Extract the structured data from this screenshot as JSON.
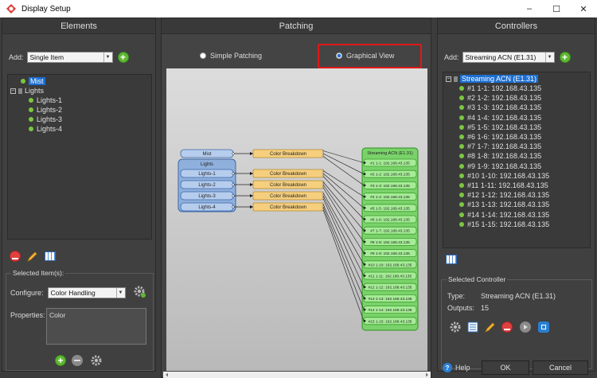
{
  "window": {
    "title": "Display Setup",
    "min": "–",
    "max": "☐",
    "close": "✕"
  },
  "elements": {
    "header": "Elements",
    "add_label": "Add:",
    "add_value": "Single Item",
    "tree": [
      {
        "label": "Mist",
        "selected": true
      },
      {
        "label": "Lights"
      },
      {
        "label": "Lights-1"
      },
      {
        "label": "Lights-2"
      },
      {
        "label": "Lights-3"
      },
      {
        "label": "Lights-4"
      }
    ],
    "selected_items": "Selected Item(s):",
    "configure_label": "Configure:",
    "configure_value": "Color Handling",
    "properties_label": "Properties:",
    "properties_value": "Color"
  },
  "patching": {
    "header": "Patching",
    "simple": "Simple Patching",
    "graphical": "Graphical View",
    "graph": {
      "mist": "Mist",
      "group": "Lights",
      "lights": [
        "Lights-1",
        "Lights-2",
        "Lights-3",
        "Lights-4"
      ],
      "breakdown": "Color Breakdown",
      "controller": "Streaming ACN (E1.31)",
      "outputs": [
        "#1 1-1: 192.168.43.135",
        "#2 1-2: 192.168.43.135",
        "#3 1-3: 192.168.43.135",
        "#4 1-4: 192.168.43.135",
        "#5 1-5: 192.168.43.135",
        "#6 1-6: 192.168.43.135",
        "#7 1-7: 192.168.43.135",
        "#8 1-8: 192.168.43.135",
        "#9 1-9: 192.168.43.135",
        "#10 1-10: 192.168.43.135",
        "#11 1-11: 192.168.43.135",
        "#12 1-12: 192.168.43.135",
        "#13 1-13: 192.168.43.135",
        "#14 1-14: 192.168.43.135",
        "#15 1-15: 192.168.43.135"
      ]
    }
  },
  "controllers": {
    "header": "Controllers",
    "add_label": "Add:",
    "add_value": "Streaming ACN (E1.31)",
    "root": "Streaming ACN (E1.31)",
    "outputs": [
      "#1 1-1: 192.168.43.135",
      "#2 1-2: 192.168.43.135",
      "#3 1-3: 192.168.43.135",
      "#4 1-4: 192.168.43.135",
      "#5 1-5: 192.168.43.135",
      "#6 1-6: 192.168.43.135",
      "#7 1-7: 192.168.43.135",
      "#8 1-8: 192.168.43.135",
      "#9 1-9: 192.168.43.135",
      "#10 1-10: 192.168.43.135",
      "#11 1-11: 192.168.43.135",
      "#12 1-12: 192.168.43.135",
      "#13 1-13: 192.168.43.135",
      "#14 1-14: 192.168.43.135",
      "#15 1-15: 192.168.43.135"
    ],
    "selected_controller": "Selected Controller",
    "type_label": "Type:",
    "type_value": "Streaming ACN (E1.31)",
    "outputs_label": "Outputs:",
    "outputs_value": "15"
  },
  "footer": {
    "help": "Help",
    "ok": "OK",
    "cancel": "Cancel"
  },
  "colors": {
    "accent": "#1c6ed0",
    "green": "#5fb832",
    "highlight": "#e01818"
  }
}
